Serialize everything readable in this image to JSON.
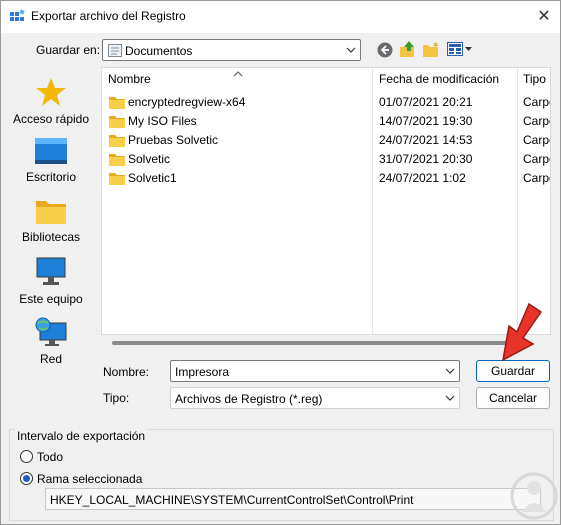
{
  "window": {
    "title": "Exportar archivo del Registro",
    "close": "✕"
  },
  "toolbar": {
    "save_in_label": "Guardar en:",
    "save_in_value": "Documentos"
  },
  "places": [
    {
      "label": "Acceso rápido",
      "icon": "star-icon"
    },
    {
      "label": "Escritorio",
      "icon": "desktop-icon"
    },
    {
      "label": "Bibliotecas",
      "icon": "library-folder-icon"
    },
    {
      "label": "Este equipo",
      "icon": "computer-icon"
    },
    {
      "label": "Red",
      "icon": "network-icon"
    }
  ],
  "file_list": {
    "columns": [
      "Nombre",
      "Fecha de modificación",
      "Tipo"
    ],
    "rows": [
      {
        "name": "encryptedregview-x64",
        "date": "01/07/2021 20:21",
        "type": "Carpe"
      },
      {
        "name": "My ISO Files",
        "date": "14/07/2021 19:30",
        "type": "Carpe"
      },
      {
        "name": "Pruebas Solvetic",
        "date": "24/07/2021 14:53",
        "type": "Carpe"
      },
      {
        "name": "Solvetic",
        "date": "31/07/2021 20:30",
        "type": "Carpe"
      },
      {
        "name": "Solvetic1",
        "date": "24/07/2021 1:02",
        "type": "Carpe"
      }
    ]
  },
  "form": {
    "name_label": "Nombre:",
    "name_value": "Impresora",
    "type_label": "Tipo:",
    "type_value": "Archivos de Registro (*.reg)",
    "save_button": "Guardar",
    "cancel_button": "Cancelar"
  },
  "export_range": {
    "title": "Intervalo de exportación",
    "option_all": "Todo",
    "option_selected": "Rama seleccionada",
    "selected_option": "Rama seleccionada",
    "key_path": "HKEY_LOCAL_MACHINE\\SYSTEM\\CurrentControlSet\\Control\\Print"
  },
  "colors": {
    "accent": "#0067c0",
    "folder": "#f4c542",
    "arrow": "#e8332a"
  }
}
